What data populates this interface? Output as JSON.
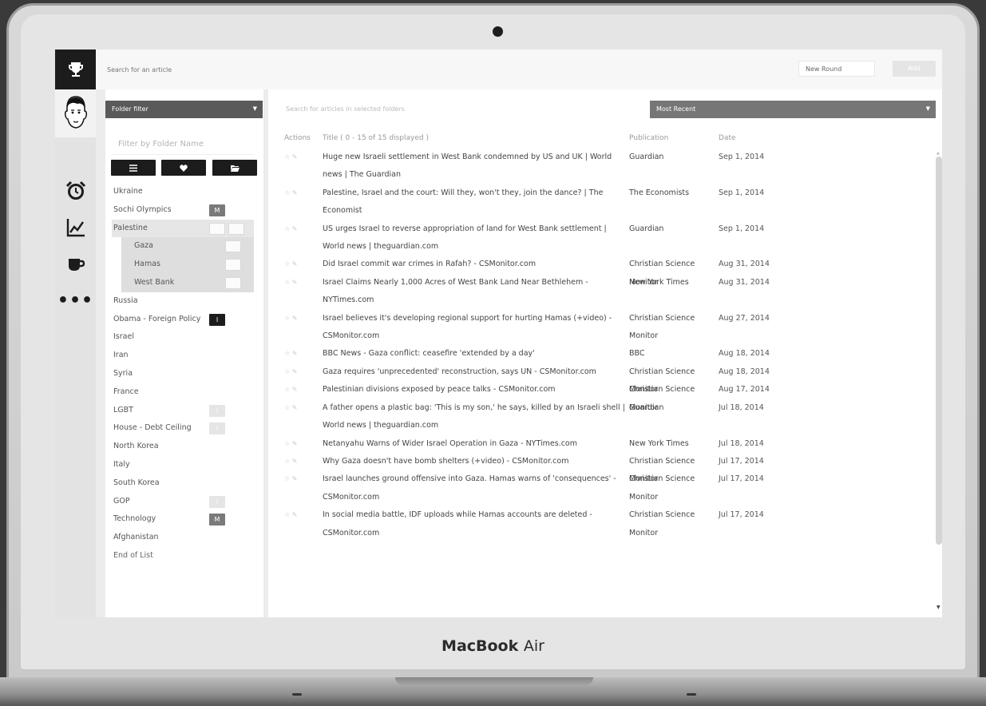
{
  "device": {
    "brand": "MacBook",
    "model": "Air"
  },
  "topbar": {
    "search_placeholder": "Search for an article",
    "new_round": "New Round",
    "add_label": "Add"
  },
  "left": {
    "folder_filter": "Folder filter",
    "filter_placeholder": "Filter by Folder Name",
    "folders": [
      {
        "name": "Ukraine",
        "badge": "",
        "badge_style": "",
        "selected": false,
        "sub": false
      },
      {
        "name": "Sochi Olympics",
        "badge": "M",
        "badge_style": "grey",
        "selected": false,
        "sub": false
      },
      {
        "name": "Palestine",
        "badge": "",
        "badge_style": "box",
        "selected": true,
        "sub": false
      },
      {
        "name": "Gaza",
        "badge": "",
        "badge_style": "box",
        "selected": true,
        "sub": true
      },
      {
        "name": "Hamas",
        "badge": "",
        "badge_style": "box",
        "selected": true,
        "sub": true
      },
      {
        "name": "West Bank",
        "badge": "",
        "badge_style": "box",
        "selected": true,
        "sub": true
      },
      {
        "name": "Russia",
        "badge": "",
        "badge_style": "",
        "selected": false,
        "sub": false
      },
      {
        "name": "Obama - Foreign Policy",
        "badge": "I",
        "badge_style": "dark",
        "selected": false,
        "sub": false
      },
      {
        "name": "Israel",
        "badge": "",
        "badge_style": "",
        "selected": false,
        "sub": false
      },
      {
        "name": "Iran",
        "badge": "",
        "badge_style": "",
        "selected": false,
        "sub": false
      },
      {
        "name": "Syria",
        "badge": "",
        "badge_style": "",
        "selected": false,
        "sub": false
      },
      {
        "name": "France",
        "badge": "",
        "badge_style": "",
        "selected": false,
        "sub": false
      },
      {
        "name": "LGBT",
        "badge": "I",
        "badge_style": "light",
        "selected": false,
        "sub": false
      },
      {
        "name": "House - Debt Ceiling",
        "badge": "I",
        "badge_style": "light",
        "selected": false,
        "sub": false
      },
      {
        "name": "North Korea",
        "badge": "",
        "badge_style": "",
        "selected": false,
        "sub": false
      },
      {
        "name": "Italy",
        "badge": "",
        "badge_style": "",
        "selected": false,
        "sub": false
      },
      {
        "name": "South Korea",
        "badge": "",
        "badge_style": "",
        "selected": false,
        "sub": false
      },
      {
        "name": "GOP",
        "badge": "I",
        "badge_style": "light",
        "selected": false,
        "sub": false
      },
      {
        "name": "Technology",
        "badge": "M",
        "badge_style": "grey",
        "selected": false,
        "sub": false
      },
      {
        "name": "Afghanistan",
        "badge": "",
        "badge_style": "",
        "selected": false,
        "sub": false
      },
      {
        "name": "End of List",
        "badge": "",
        "badge_style": "",
        "selected": false,
        "sub": false,
        "end": true
      }
    ]
  },
  "main": {
    "article_search_placeholder": "Search for articles in selected folders",
    "sort": "Most Recent",
    "headers": {
      "actions": "Actions",
      "title": "Title ( 0 - 15 of 15 displayed )",
      "publication": "Publication",
      "date": "Date"
    },
    "rows": [
      {
        "title": "Huge new Israeli settlement in West Bank condemned by US and UK | World news | The Guardian",
        "pub": "Guardian",
        "date": "Sep 1, 2014"
      },
      {
        "title": "Palestine, Israel and the court: Will they, won't they, join the dance? | The Economist",
        "pub": "The Economists",
        "date": "Sep 1, 2014"
      },
      {
        "title": "US urges Israel to reverse appropriation of land for West Bank settlement | World news | theguardian.com",
        "pub": "Guardian",
        "date": "Sep 1, 2014"
      },
      {
        "title": "Did Israel commit war crimes in Rafah? - CSMonitor.com",
        "pub": "Christian Science Monitor",
        "date": "Aug 31, 2014"
      },
      {
        "title": "Israel Claims Nearly 1,000 Acres of West Bank Land Near Bethlehem - NYTimes.com",
        "pub": "New York Times",
        "date": "Aug 31, 2014"
      },
      {
        "title": "Israel believes it's developing regional support for hurting Hamas (+video) - CSMonitor.com",
        "pub": "Christian Science Monitor",
        "date": "Aug 27, 2014"
      },
      {
        "title": "BBC News - Gaza conflict: ceasefire 'extended by a day'",
        "pub": "BBC",
        "date": "Aug 18, 2014"
      },
      {
        "title": "Gaza requires 'unprecedented' reconstruction, says UN - CSMonitor.com",
        "pub": "Christian Science Monitor",
        "date": "Aug 18, 2014"
      },
      {
        "title": "Palestinian divisions exposed by peace talks - CSMonitor.com",
        "pub": "Christian Science Monitor",
        "date": "Aug 17, 2014"
      },
      {
        "title": "A father opens a plastic bag: 'This is my son,' he says, killed by an Israeli shell | World news | theguardian.com",
        "pub": "Guardian",
        "date": "Jul 18, 2014"
      },
      {
        "title": "Netanyahu Warns of Wider Israel Operation in Gaza - NYTimes.com",
        "pub": "New York Times",
        "date": "Jul 18, 2014"
      },
      {
        "title": "Why Gaza doesn't have bomb shelters (+video) - CSMonitor.com",
        "pub": "Christian Science Monitor",
        "date": "Jul 17, 2014"
      },
      {
        "title": "Israel launches ground offensive into Gaza. Hamas warns of 'consequences' - CSMonitor.com",
        "pub": "Christian Science Monitor",
        "date": "Jul 17, 2014"
      },
      {
        "title": "In social media battle, IDF uploads while Hamas accounts are deleted - CSMonitor.com",
        "pub": "Christian Science Monitor",
        "date": "Jul 17, 2014"
      }
    ]
  },
  "icons": [
    "trophy-icon",
    "avatar",
    "alarm-clock-icon",
    "line-chart-icon",
    "coffee-cup-icon",
    "more-dots-icon",
    "list-icon",
    "heart-icon",
    "folder-open-icon",
    "star-icon",
    "edit-icon"
  ]
}
